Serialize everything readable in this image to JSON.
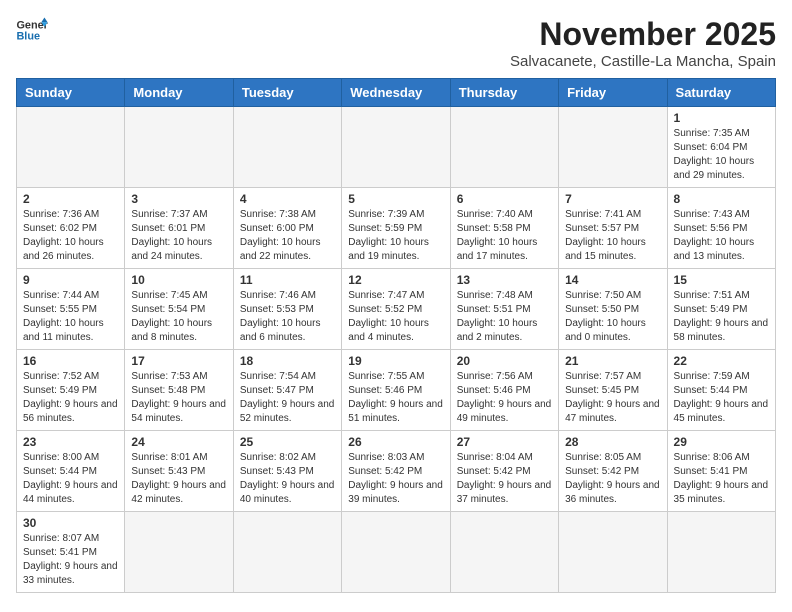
{
  "header": {
    "logo_general": "General",
    "logo_blue": "Blue",
    "month_title": "November 2025",
    "subtitle": "Salvacanete, Castille-La Mancha, Spain"
  },
  "weekdays": [
    "Sunday",
    "Monday",
    "Tuesday",
    "Wednesday",
    "Thursday",
    "Friday",
    "Saturday"
  ],
  "days": [
    {
      "num": "",
      "info": ""
    },
    {
      "num": "",
      "info": ""
    },
    {
      "num": "",
      "info": ""
    },
    {
      "num": "",
      "info": ""
    },
    {
      "num": "",
      "info": ""
    },
    {
      "num": "",
      "info": ""
    },
    {
      "num": "1",
      "info": "Sunrise: 7:35 AM\nSunset: 6:04 PM\nDaylight: 10 hours and 29 minutes."
    },
    {
      "num": "2",
      "info": "Sunrise: 7:36 AM\nSunset: 6:02 PM\nDaylight: 10 hours and 26 minutes."
    },
    {
      "num": "3",
      "info": "Sunrise: 7:37 AM\nSunset: 6:01 PM\nDaylight: 10 hours and 24 minutes."
    },
    {
      "num": "4",
      "info": "Sunrise: 7:38 AM\nSunset: 6:00 PM\nDaylight: 10 hours and 22 minutes."
    },
    {
      "num": "5",
      "info": "Sunrise: 7:39 AM\nSunset: 5:59 PM\nDaylight: 10 hours and 19 minutes."
    },
    {
      "num": "6",
      "info": "Sunrise: 7:40 AM\nSunset: 5:58 PM\nDaylight: 10 hours and 17 minutes."
    },
    {
      "num": "7",
      "info": "Sunrise: 7:41 AM\nSunset: 5:57 PM\nDaylight: 10 hours and 15 minutes."
    },
    {
      "num": "8",
      "info": "Sunrise: 7:43 AM\nSunset: 5:56 PM\nDaylight: 10 hours and 13 minutes."
    },
    {
      "num": "9",
      "info": "Sunrise: 7:44 AM\nSunset: 5:55 PM\nDaylight: 10 hours and 11 minutes."
    },
    {
      "num": "10",
      "info": "Sunrise: 7:45 AM\nSunset: 5:54 PM\nDaylight: 10 hours and 8 minutes."
    },
    {
      "num": "11",
      "info": "Sunrise: 7:46 AM\nSunset: 5:53 PM\nDaylight: 10 hours and 6 minutes."
    },
    {
      "num": "12",
      "info": "Sunrise: 7:47 AM\nSunset: 5:52 PM\nDaylight: 10 hours and 4 minutes."
    },
    {
      "num": "13",
      "info": "Sunrise: 7:48 AM\nSunset: 5:51 PM\nDaylight: 10 hours and 2 minutes."
    },
    {
      "num": "14",
      "info": "Sunrise: 7:50 AM\nSunset: 5:50 PM\nDaylight: 10 hours and 0 minutes."
    },
    {
      "num": "15",
      "info": "Sunrise: 7:51 AM\nSunset: 5:49 PM\nDaylight: 9 hours and 58 minutes."
    },
    {
      "num": "16",
      "info": "Sunrise: 7:52 AM\nSunset: 5:49 PM\nDaylight: 9 hours and 56 minutes."
    },
    {
      "num": "17",
      "info": "Sunrise: 7:53 AM\nSunset: 5:48 PM\nDaylight: 9 hours and 54 minutes."
    },
    {
      "num": "18",
      "info": "Sunrise: 7:54 AM\nSunset: 5:47 PM\nDaylight: 9 hours and 52 minutes."
    },
    {
      "num": "19",
      "info": "Sunrise: 7:55 AM\nSunset: 5:46 PM\nDaylight: 9 hours and 51 minutes."
    },
    {
      "num": "20",
      "info": "Sunrise: 7:56 AM\nSunset: 5:46 PM\nDaylight: 9 hours and 49 minutes."
    },
    {
      "num": "21",
      "info": "Sunrise: 7:57 AM\nSunset: 5:45 PM\nDaylight: 9 hours and 47 minutes."
    },
    {
      "num": "22",
      "info": "Sunrise: 7:59 AM\nSunset: 5:44 PM\nDaylight: 9 hours and 45 minutes."
    },
    {
      "num": "23",
      "info": "Sunrise: 8:00 AM\nSunset: 5:44 PM\nDaylight: 9 hours and 44 minutes."
    },
    {
      "num": "24",
      "info": "Sunrise: 8:01 AM\nSunset: 5:43 PM\nDaylight: 9 hours and 42 minutes."
    },
    {
      "num": "25",
      "info": "Sunrise: 8:02 AM\nSunset: 5:43 PM\nDaylight: 9 hours and 40 minutes."
    },
    {
      "num": "26",
      "info": "Sunrise: 8:03 AM\nSunset: 5:42 PM\nDaylight: 9 hours and 39 minutes."
    },
    {
      "num": "27",
      "info": "Sunrise: 8:04 AM\nSunset: 5:42 PM\nDaylight: 9 hours and 37 minutes."
    },
    {
      "num": "28",
      "info": "Sunrise: 8:05 AM\nSunset: 5:42 PM\nDaylight: 9 hours and 36 minutes."
    },
    {
      "num": "29",
      "info": "Sunrise: 8:06 AM\nSunset: 5:41 PM\nDaylight: 9 hours and 35 minutes."
    },
    {
      "num": "30",
      "info": "Sunrise: 8:07 AM\nSunset: 5:41 PM\nDaylight: 9 hours and 33 minutes."
    },
    {
      "num": "",
      "info": ""
    },
    {
      "num": "",
      "info": ""
    },
    {
      "num": "",
      "info": ""
    },
    {
      "num": "",
      "info": ""
    },
    {
      "num": "",
      "info": ""
    },
    {
      "num": "",
      "info": ""
    }
  ]
}
